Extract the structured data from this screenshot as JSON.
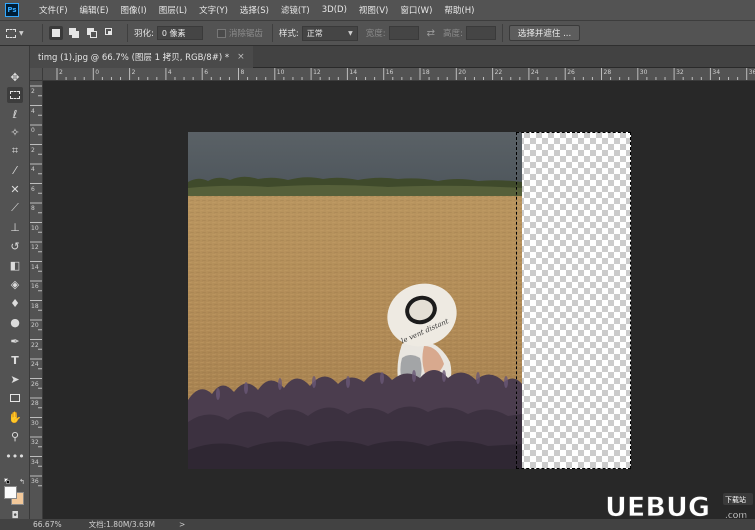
{
  "menu": {
    "app_logo": "Ps",
    "items": [
      "文件(F)",
      "编辑(E)",
      "图像(I)",
      "图层(L)",
      "文字(Y)",
      "选择(S)",
      "滤镜(T)",
      "3D(D)",
      "视图(V)",
      "窗口(W)",
      "帮助(H)"
    ]
  },
  "options": {
    "feather_label": "羽化:",
    "feather_value": "0 像素",
    "antialias_label": "消除锯齿",
    "style_label": "样式:",
    "style_value": "正常",
    "width_label": "宽度:",
    "height_label": "高度:",
    "select_mask_button": "选择并遮住 ..."
  },
  "document": {
    "tab_title": "timg (1).jpg @ 66.7% (图层 1 拷贝, RGB/8#) *",
    "hat_text": "le vent distant"
  },
  "ruler": {
    "top": [
      "2",
      "0",
      "2",
      "4",
      "6",
      "8",
      "10",
      "12",
      "14",
      "16",
      "18",
      "20",
      "22",
      "24",
      "26",
      "28",
      "30",
      "32",
      "34",
      "36"
    ],
    "left": [
      "2",
      "4",
      "0",
      "2",
      "4",
      "6",
      "8",
      "10",
      "12",
      "14",
      "16",
      "18",
      "20",
      "22",
      "24",
      "26",
      "28",
      "30",
      "32",
      "34",
      "36"
    ]
  },
  "status": {
    "zoom": "66.67%",
    "doc_info": "文档:1.80M/3.63M",
    "arrow": ">"
  },
  "watermark": {
    "text": "UEBUG",
    "badge": "下载站",
    "domain": ".com"
  },
  "colors": {
    "foreground": "#fbfbfb",
    "background": "#f2c89a",
    "accent": "#31a8ff"
  },
  "icons": {
    "tools": [
      "move-icon",
      "rect-marquee-icon",
      "lasso-icon",
      "magic-wand-icon",
      "crop-icon",
      "eyedropper-icon",
      "healing-brush-icon",
      "brush-icon",
      "clone-stamp-icon",
      "history-brush-icon",
      "eraser-icon",
      "paint-bucket-icon",
      "blur-icon",
      "dodge-icon",
      "pen-icon",
      "type-icon",
      "path-select-icon",
      "rectangle-shape-icon",
      "hand-icon",
      "zoom-icon",
      "more-tools-icon"
    ]
  }
}
